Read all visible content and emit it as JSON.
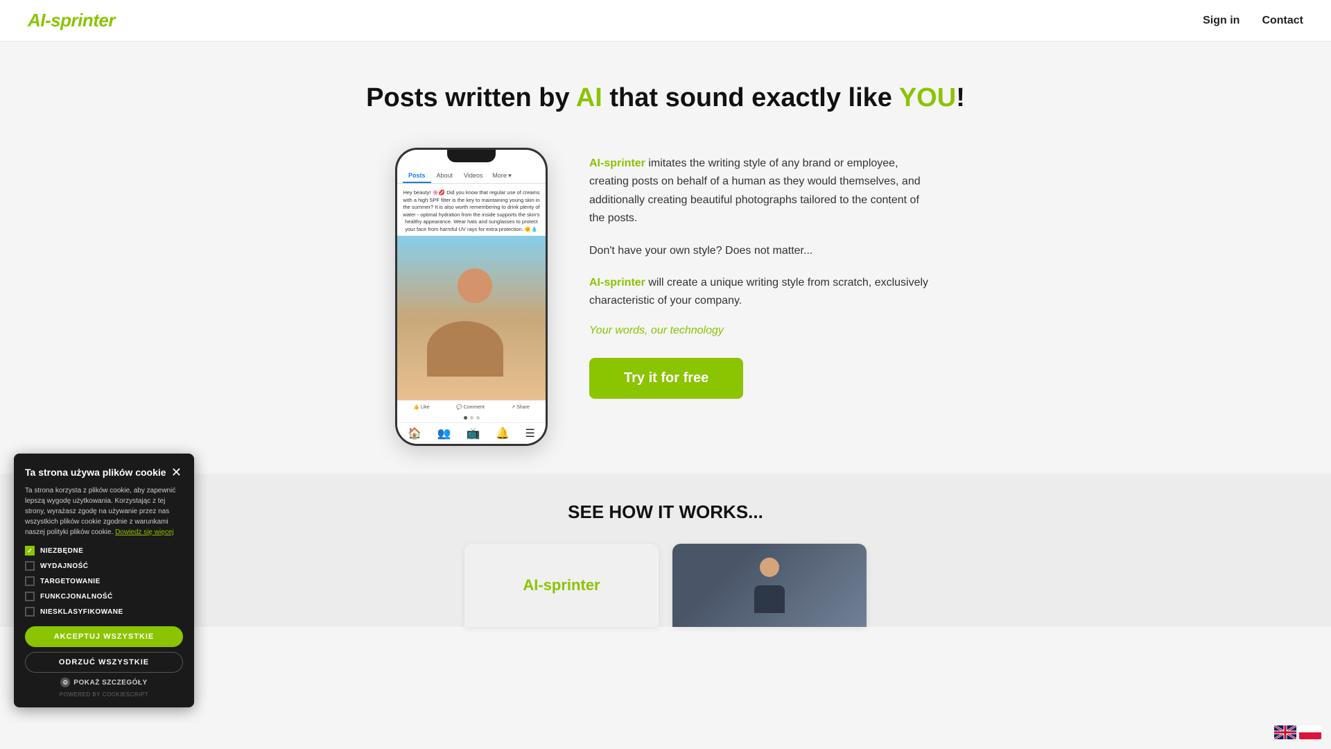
{
  "nav": {
    "logo": "AI-sprinter",
    "sign_in": "Sign in",
    "contact": "Contact"
  },
  "hero": {
    "title_part1": "Posts written by ",
    "title_ai": "AI",
    "title_part2": " that sound exactly like ",
    "title_you": "YOU",
    "title_end": "!",
    "description1_brand": "AI-sprinter",
    "description1": " imitates the writing style of any brand or employee, creating posts on behalf of a human as they would themselves, and additionally creating beautiful photographs tailored to the content of the posts.",
    "description2": "Don't have your own style? Does not matter...",
    "description3_brand": "AI-sprinter",
    "description3": " will create a unique writing style from scratch, exclusively characteristic of your company.",
    "tagline": "Your words, our technology",
    "cta_button": "Try it for free"
  },
  "phone": {
    "tabs": [
      "Posts",
      "About",
      "Videos",
      "More"
    ],
    "post_text": "Hey beauty! 🌸💋 Did you know that regular use of creams with a high SPF filter is the key to maintaining young skin in the summer? It is also worth remembering to drink plenty of water - optimal hydration from the inside supports the skin's healthy appearance. Wear hats and sunglasses to protect your face from harmful UV rays for extra protection. 🌞💧",
    "actions": [
      "👍 Like",
      "💬 Comment",
      "↗ Share"
    ],
    "nav_icons": [
      "🏠",
      "👥",
      "📺",
      "🔔",
      "☰"
    ]
  },
  "see_how": {
    "title": "SEE HOW IT WORKS...",
    "card1_logo": "AI-sprinter"
  },
  "cookie": {
    "title": "Ta strona używa plików cookie",
    "description": "Ta strona korzysta z plików cookie, aby zapewnić lepszą wygodę użytkowania. Korzystając z tej strony, wyrażasz zgodę na używanie przez nas wszystkich plików cookie zgodnie z warunkami naszej polityki plików cookie.",
    "link": "Dowiedz się więcej",
    "checkboxes": [
      {
        "label": "NIEZBĘDNE",
        "checked": true
      },
      {
        "label": "WYDAJNOŚĆ",
        "checked": false
      },
      {
        "label": "TARGETOWANIE",
        "checked": false
      },
      {
        "label": "FUNKCJONALNOŚĆ",
        "checked": false
      },
      {
        "label": "NIESKLASYFIKOWANE",
        "checked": false
      }
    ],
    "accept_all": "AKCEPTUJ WSZYSTKIE",
    "reject_all": "ODRZUĆ WSZYSTKIE",
    "details": "POKAŻ SZCZEGÓŁY",
    "powered": "POWERED BY COOKIESCRIPT"
  }
}
